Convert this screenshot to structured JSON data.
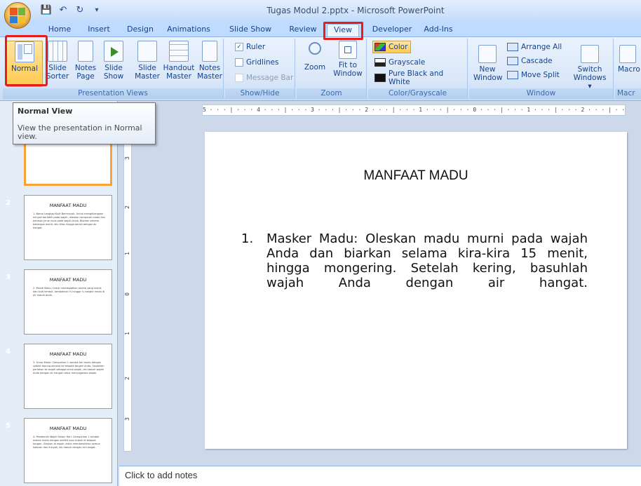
{
  "window": {
    "title": "Tugas Modul 2.pptx - Microsoft PowerPoint"
  },
  "tabs": [
    "Home",
    "Insert",
    "Design",
    "Animations",
    "Slide Show",
    "Review",
    "View",
    "Developer",
    "Add-Ins"
  ],
  "active_tab": "View",
  "ribbon": {
    "presentation_views": {
      "label": "Presentation Views",
      "buttons": [
        {
          "l1": "Normal",
          "l2": ""
        },
        {
          "l1": "Slide",
          "l2": "Sorter"
        },
        {
          "l1": "Notes",
          "l2": "Page"
        },
        {
          "l1": "Slide",
          "l2": "Show"
        },
        {
          "l1": "Slide",
          "l2": "Master"
        },
        {
          "l1": "Handout",
          "l2": "Master"
        },
        {
          "l1": "Notes",
          "l2": "Master"
        }
      ]
    },
    "show_hide": {
      "label": "Show/Hide",
      "ruler": "Ruler",
      "gridlines": "Gridlines",
      "message_bar": "Message Bar"
    },
    "zoom": {
      "label": "Zoom",
      "zoom_l1": "Zoom",
      "fit_l1": "Fit to",
      "fit_l2": "Window"
    },
    "color": {
      "label": "Color/Grayscale",
      "color": "Color",
      "grayscale": "Grayscale",
      "pure_bw": "Pure Black and White"
    },
    "window": {
      "label": "Window",
      "new_l1": "New",
      "new_l2": "Window",
      "arrange_all": "Arrange All",
      "cascade": "Cascade",
      "move_split": "Move Split",
      "switch_l1": "Switch",
      "switch_l2": "Windows ▾"
    },
    "macros": {
      "label": "Macr",
      "btn": "Macro"
    }
  },
  "tooltip": {
    "title": "Normal View",
    "body_l1": "View the presentation in Normal",
    "body_l2": "view."
  },
  "thumbnails": [
    {
      "num": "",
      "title": "",
      "body": "wajah Anda dan biarkan selama kira-kira 15 menit, hingga mongering. Setelah kering, basuhlah wajah Anda dengan air hangat."
    },
    {
      "num": "2",
      "title": "MANFAAT MADU",
      "body": "1. Nama Lengkap Kulit Berminyak. Untuk menghilangkan minyak berlebih pada wajah, oleskan campuran madu dan perasan jeruk nipis pada wajah Anda. Biarkan selama beberapa menit, lalu bilas hingga bersih dengan air hangat."
    },
    {
      "num": "3",
      "title": "MANFAAT MADU",
      "body": "2. Mandi Madu: Untuk mendapatkan aroma yang manis dan kulit lembut, tambahkan ½ hingga ¾ cangkir madu di air mandi Anda."
    },
    {
      "num": "4",
      "title": "MANFAAT MADU",
      "body": "3. Scrub Madu: Campurkan 1 sendok teh madu dengan sedikit tepung almond ke telapak tangan Anda. Gosokkan perlahan ke wajah sebagai scrub wajah, lalu basuh wajah Anda dengan air hangat untuk menyegarkan wajah."
    },
    {
      "num": "5",
      "title": "MANFAAT MADU",
      "body": "4. Pembersih Wajah Selain Hari. Campurkan 1 sendok makan madu dengan sedikit susu bubuk di telapak tangan. Oleskan di wajah untuk membersihkan semua kotoran dan minyak, lalu basuh dengan air hangat."
    }
  ],
  "ruler": {
    "horizontal": "5 · · · | · · · 4 · · · | · · · 3 · · · | · · · 2 · · · | · · · 1 · · · | · · · 0 · · · | · · · 1 · · · | · · · 2 · · · | · · · 3 · · · | · · · 4 · · · | · · ·",
    "vertical": [
      "3",
      "2",
      "1",
      "0",
      "1",
      "2",
      "3"
    ]
  },
  "slide": {
    "title": "MANFAAT MADU",
    "item_num": "1.",
    "item_text": "Masker Madu: Oleskan madu murni pada wajah Anda dan biarkan selama kira-kira 15 menit, hingga mongering. Setelah kering, basuhlah wajah Anda dengan air hangat."
  },
  "notes": {
    "placeholder": "Click to add notes"
  },
  "colors": {
    "highlight": "#e41d1d",
    "selected_thumb": "#f8a23a",
    "ribbon_text": "#15428b"
  }
}
